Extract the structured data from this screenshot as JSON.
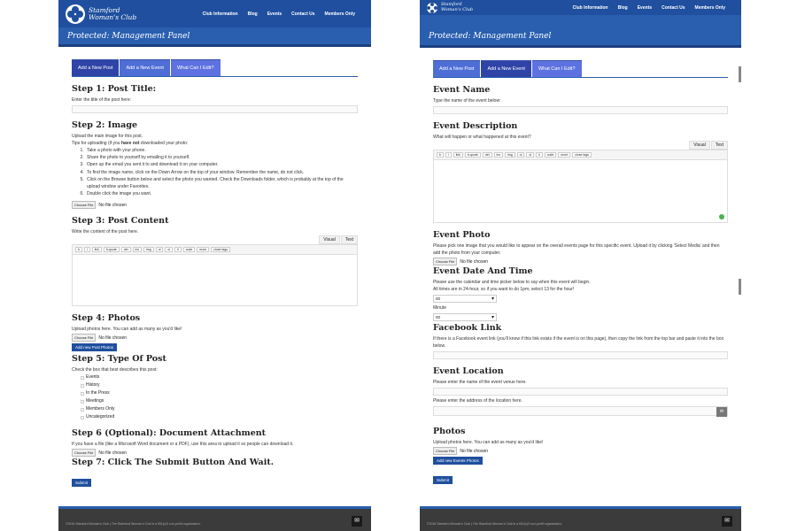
{
  "site": {
    "logo_line1": "Stamford",
    "logo_line2": "Woman's Club",
    "nav": [
      "Club Information",
      "Blog",
      "Events",
      "Contact Us",
      "Members Only"
    ],
    "page_title": "Protected: Management Panel",
    "footer": "©2016 Stamford Woman's Club | The Stamford Woman's Club is a 501(c)3 non-profit organization."
  },
  "tabs": [
    "Add a New Post",
    "Add a New Event",
    "What Can I Edit?"
  ],
  "editor": {
    "visual": "Visual",
    "text": "Text",
    "toolbar": [
      "b",
      "i",
      "link",
      "b-quote",
      "del",
      "ins",
      "img",
      "ul",
      "ol",
      "li",
      "code",
      "more",
      "close tags"
    ]
  },
  "file": {
    "button": "Choose File",
    "empty": "No file chosen"
  },
  "post": {
    "step1_title": "Step 1: Post Title:",
    "step1_hint": "Enter the title of the post here:",
    "step2_title": "Step 2: Image",
    "step2_intro": "Upload the main image for this post.",
    "step2_tips_prefix": "Tips for uploading (if you",
    "step2_tips_bold": "have not",
    "step2_tips_suffix": "downloaded your photo:",
    "step2_list": [
      "Take a photo with your phone.",
      "Share the photo to yourself by emailing it to yourself.",
      "Open up the email you sent it to and download it on your computer.",
      "To find the image name, click on the Down Arrow on the top of your window. Remember the name, do not click.",
      "Click on the Browse button below and select the photo you wanted. Check the Downloads folder, which is probably at the top of the upload window under Favorites.",
      "Double click the image you want."
    ],
    "step3_title": "Step 3: Post Content",
    "step3_hint": "Write the content of the post here.",
    "step4_title": "Step 4: Photos",
    "step4_hint": "Upload photos here. You can add as many as you'd like!",
    "add_photos": "Add new Post Photos",
    "step5_title": "Step 5: Type Of Post",
    "step5_hint": "Check the box that best describes this post:",
    "categories": [
      "Events",
      "History",
      "In the Press",
      "Meetings",
      "Members Only",
      "Uncategorized"
    ],
    "step6_title": "Step 6 (Optional): Document Attachment",
    "step6_hint": "If you have a file (like a Microsoft Word document or a PDF), use this area to upload it so people can download it.",
    "step7_title": "Step 7: Click The Submit Button And Wait.",
    "submit": "Submit"
  },
  "event": {
    "name_title": "Event Name",
    "name_hint": "Type the name of the event below:",
    "desc_title": "Event Description",
    "desc_hint": "What will happen or what happened at this event?",
    "photo_title": "Event Photo",
    "photo_hint": "Please pick one image that you would like to appear on the overall events page for this specific event. Upload it by clicking 'Select Media' and then add the photo from your computer.",
    "date_title": "Event Date And Time",
    "date_hint1": "Please use the calendar and time picker below to say when this event will begin.",
    "date_hint2": "All times are in 24-hour, so if you want to do 1pm, select 13 for the hour!",
    "hour_value": "00",
    "minute_label": "Minute",
    "minute_value": "00",
    "fb_title": "Facebook Link",
    "fb_hint": "If there is a Facebook event link (you'll know if this link exists if the event is on this page), then copy the link from the top bar and paste it into the box below.",
    "loc_title": "Event Location",
    "loc_hint1": "Please enter the name of the event venue here.",
    "loc_hint2": "Please enter the address of the location here.",
    "photos_title": "Photos",
    "photos_hint": "Upload photos here. You can add as many as you'd like!",
    "add_photos": "Add new Events Photos",
    "submit": "Submit"
  }
}
